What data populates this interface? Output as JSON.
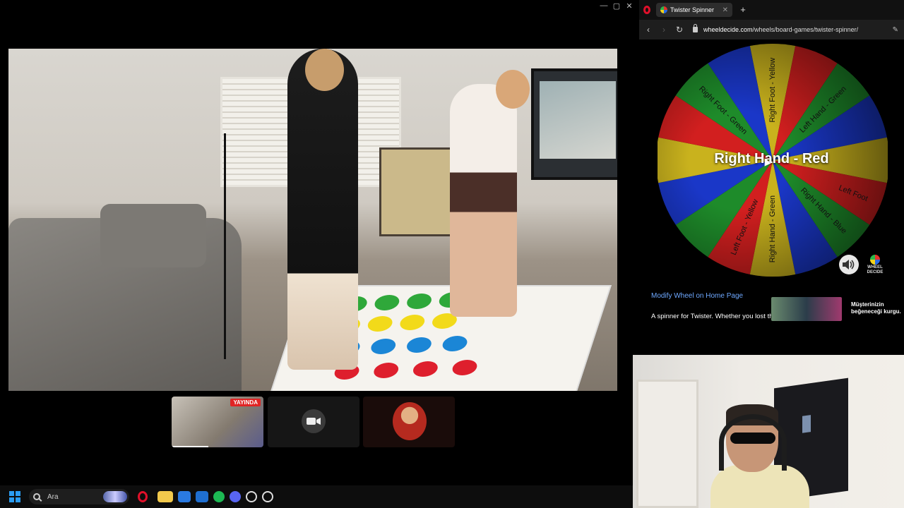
{
  "left_window": {
    "controls": [
      "—",
      "▢",
      "✕"
    ]
  },
  "thumbnails": [
    {
      "badge": "YAYINDA"
    },
    {
      "kind": "camera-off"
    },
    {
      "kind": "avatar"
    }
  ],
  "taskbar": {
    "search_placeholder": "Ara",
    "apps": [
      {
        "name": "opera",
        "color": "#e0102a"
      },
      {
        "name": "file-explorer",
        "color": "#f2c94c"
      },
      {
        "name": "store",
        "color": "#2a7ae2"
      },
      {
        "name": "mail",
        "color": "#1f6fd1"
      },
      {
        "name": "spotify",
        "color": "#1db954"
      },
      {
        "name": "discord",
        "color": "#5865f2"
      },
      {
        "name": "chrome-like",
        "color": "#444"
      },
      {
        "name": "obs",
        "color": "#333"
      }
    ]
  },
  "browser": {
    "tab_title": "Twister Spinner",
    "url_domain": "wheeldecide.com",
    "url_path": "/wheels/board-games/twister-spinner/",
    "result_text": "Right Hand - Red",
    "wheel": {
      "colors": [
        "#d21f1f",
        "#1e8b2a",
        "#1a37c8",
        "#c9b21d"
      ],
      "slice_count": 16,
      "visible_labels": [
        "Right Foot - Yellow",
        "Left Hand - Green",
        "Right Hand - Green",
        "Left Foot - Yellow",
        "Right Foot - Green",
        "Right Hand - Blue",
        "Left Foot"
      ]
    },
    "modify_link": "Modify Wheel on Home Page",
    "description": "A spinner for Twister. Whether you lost th",
    "ad_text": "Müşterinizin beğeneceği kurgu.",
    "logo_text": [
      "WHEEL",
      "DECIDE"
    ]
  }
}
